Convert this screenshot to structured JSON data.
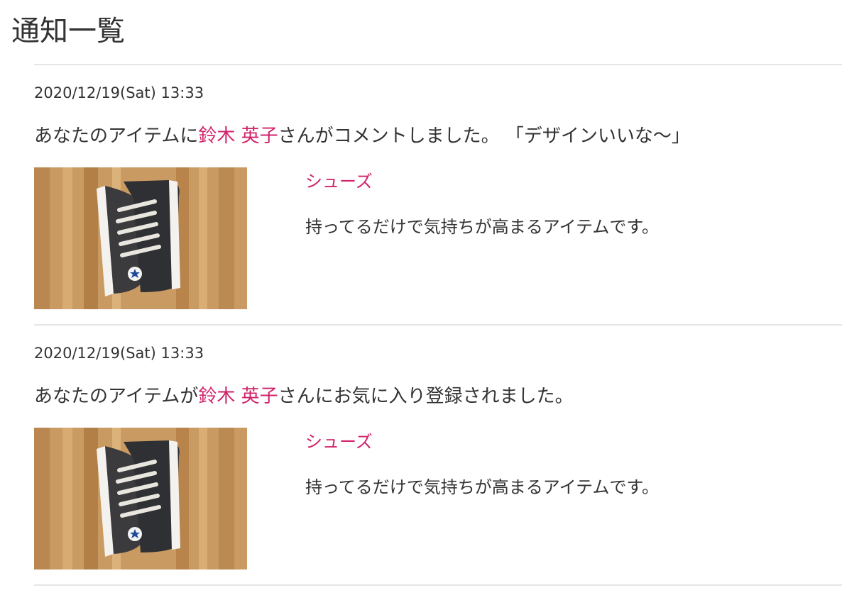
{
  "page": {
    "title": "通知一覧"
  },
  "notifications": [
    {
      "date": "2020/12/19(Sat) 13:33",
      "message_prefix": "あなたのアイテムに",
      "user_name": "鈴木 英子",
      "message_suffix": "さんがコメントしました。 「デザインいいな〜」",
      "item_name": "シューズ",
      "item_description": "持ってるだけで気持ちが高まるアイテムです。"
    },
    {
      "date": "2020/12/19(Sat) 13:33",
      "message_prefix": "あなたのアイテムが",
      "user_name": "鈴木 英子",
      "message_suffix": "さんにお気に入り登録されました。",
      "item_name": "シューズ",
      "item_description": "持ってるだけで気持ちが高まるアイテムです。"
    }
  ],
  "colors": {
    "accent": "#d1226a",
    "text": "#333333",
    "divider": "#e6e6e6"
  }
}
